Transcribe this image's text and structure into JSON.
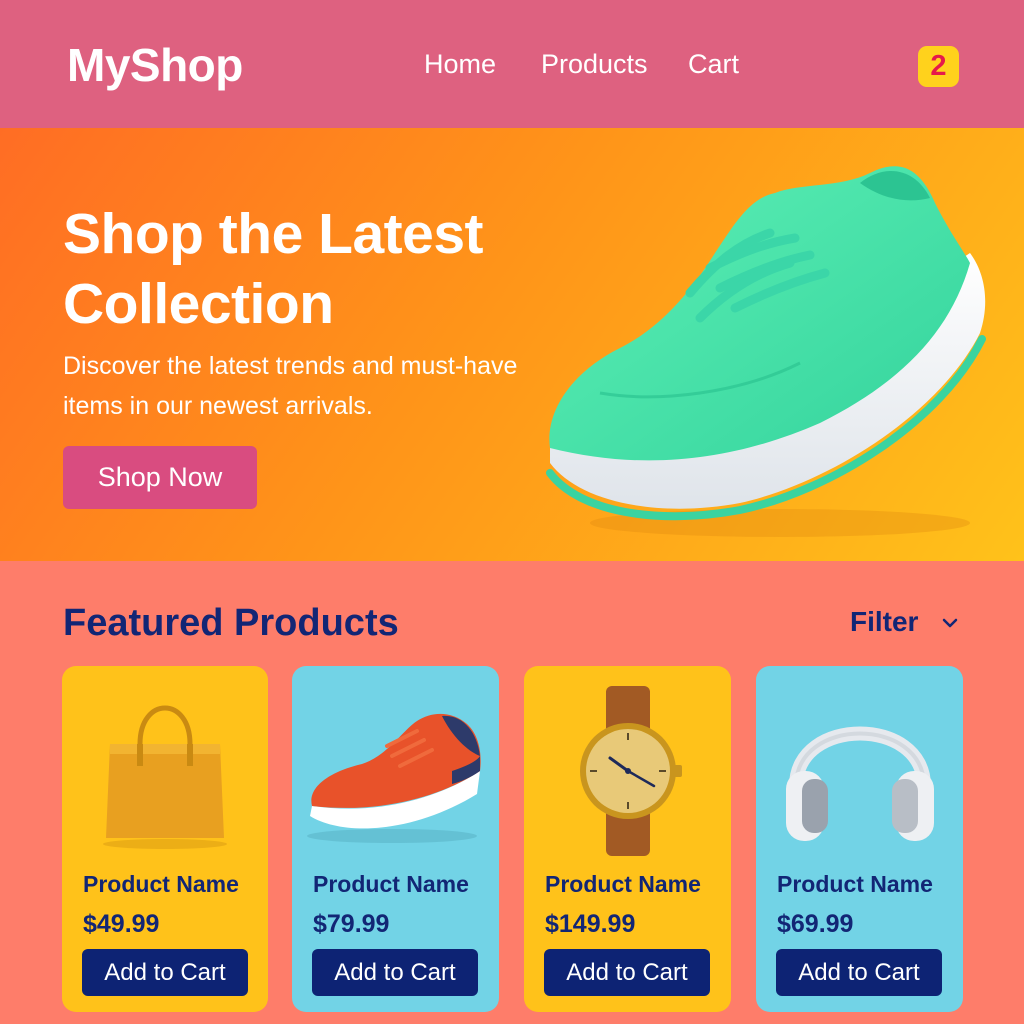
{
  "header": {
    "logo": "MyShop",
    "nav": {
      "home": "Home",
      "products": "Products",
      "cart": "Cart"
    },
    "cart_count": "2"
  },
  "hero": {
    "title": "Shop the Latest Collection",
    "subtitle": "Discover the latest trends and must-have items in our newest arrivals.",
    "cta": "Shop Now",
    "image_icon": "sneaker-image"
  },
  "featured": {
    "title": "Featured Products",
    "filter_label": "Filter",
    "products": [
      {
        "name": "Product Name",
        "price": "$49.99",
        "button": "Add to Cart",
        "image": "tote-bag-image"
      },
      {
        "name": "Product Name",
        "price": "$79.99",
        "button": "Add to Cart",
        "image": "sneaker-image"
      },
      {
        "name": "Product Name",
        "price": "$149.99",
        "button": "Add to Cart",
        "image": "watch-image"
      },
      {
        "name": "Product Name",
        "price": "$69.99",
        "button": "Add to Cart",
        "image": "headphones-image"
      }
    ]
  },
  "colors": {
    "header_bg": "#de6180",
    "page_bg": "#fe7d6a",
    "accent_pink": "#d94c80",
    "navy": "#0d2374",
    "badge_yellow": "#ffd21c",
    "card_yellow": "#ffc21a",
    "card_blue": "#72d3e6"
  }
}
